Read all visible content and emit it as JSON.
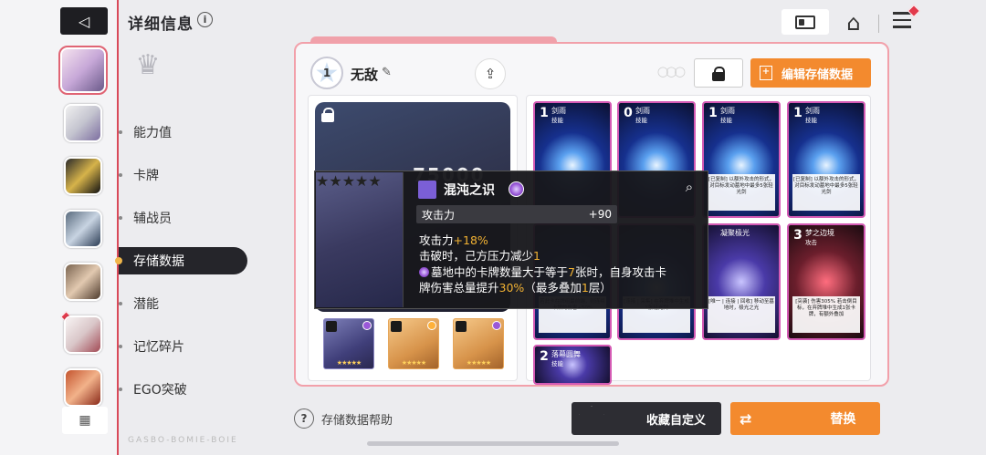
{
  "header": {
    "title": "详细信息",
    "info_icon": "info-icon",
    "back_icon": "back-triangle-icon",
    "id_icon": "id-card-icon",
    "home_icon": "home-icon",
    "menu_icon": "hamburger-menu-icon"
  },
  "sidebar": {
    "items": [
      {
        "label": "能力值"
      },
      {
        "label": "卡牌"
      },
      {
        "label": "辅战员"
      },
      {
        "label": "存储数据",
        "active": true
      },
      {
        "label": "潜能"
      },
      {
        "label": "记忆碎片"
      },
      {
        "label": "EGO突破"
      }
    ],
    "grid_icon": "grid-icon",
    "footer": "GASBO-BOMIE-BOIE"
  },
  "save": {
    "star_level": "1",
    "name": "无敌",
    "edit_icon": "pencil-icon",
    "share_icon": "share-icon",
    "lock_icon": "lock-icon",
    "edit_button": "编辑存储数据",
    "bg_numbers": "75000"
  },
  "equipment": [
    {
      "name": "gun",
      "stars": "★★★★★"
    },
    {
      "name": "teacup",
      "stars": "★★★★★"
    },
    {
      "name": "cube",
      "stars": "★★★★★"
    }
  ],
  "cards": [
    {
      "cost": "1",
      "name": "剑雨",
      "type": "技能",
      "desc": ""
    },
    {
      "cost": "0",
      "name": "剑雨",
      "type": "技能",
      "desc": ""
    },
    {
      "cost": "1",
      "name": "剑雨",
      "type": "技能",
      "desc": "[已复制] 以额外攻击的形式，对目标发动墓地中最多5张轻光剑"
    },
    {
      "cost": "1",
      "name": "剑雨",
      "type": "技能",
      "desc": "[已复制] 以额外攻击的形式，对目标发动墓地中最多5张轻光剑"
    },
    {
      "cost": "",
      "name": "",
      "type": "",
      "desc": "若此卡在牌组最前端，则连续卡牌的伤害+50%"
    },
    {
      "cost": "",
      "name": "",
      "type": "",
      "desc": "[连接 | 采集] 在弃牌堆中生成1张轻光剑"
    },
    {
      "cost": "",
      "name": "凝聚极光",
      "type": "",
      "desc": "[唯一 | 连接 | 回收] 移动至墓地时，极光之光"
    },
    {
      "cost": "3",
      "name": "梦之边境",
      "type": "攻击",
      "desc": "[突袭] 伤害305% 若击倒目标，在弃牌堆中生成1张卡牌，有额外叠加"
    },
    {
      "cost": "2",
      "name": "落幕圆舞",
      "type": "技能",
      "desc": ""
    }
  ],
  "tooltip": {
    "item_name": "混沌之识",
    "stat_label": "攻击力",
    "stat_value": "+90",
    "line1_pre": "攻击力",
    "line1_val": "+18%",
    "line2_pre": "击破时，己方压力减少",
    "line2_val": "1",
    "line3_pre": "墓地中的卡牌数量大于等于",
    "line3_val": "7",
    "line3_post": "张时，自身攻击卡",
    "line4_pre": "牌伤害总量提升",
    "line4_val": "30%",
    "line4_post": "（最多叠加",
    "line4_val2": "1",
    "line4_end": "层）",
    "stars": "★★★★★",
    "search_icon": "search-icon"
  },
  "footer": {
    "help_text": "存储数据帮助",
    "fav_button": "收藏自定义",
    "replace_button": "替换"
  },
  "colors": {
    "accent_orange": "#f38a2e",
    "accent_pink": "#f2a0aa",
    "dark": "#2d2d33",
    "highlight_yellow": "#f2b233"
  }
}
